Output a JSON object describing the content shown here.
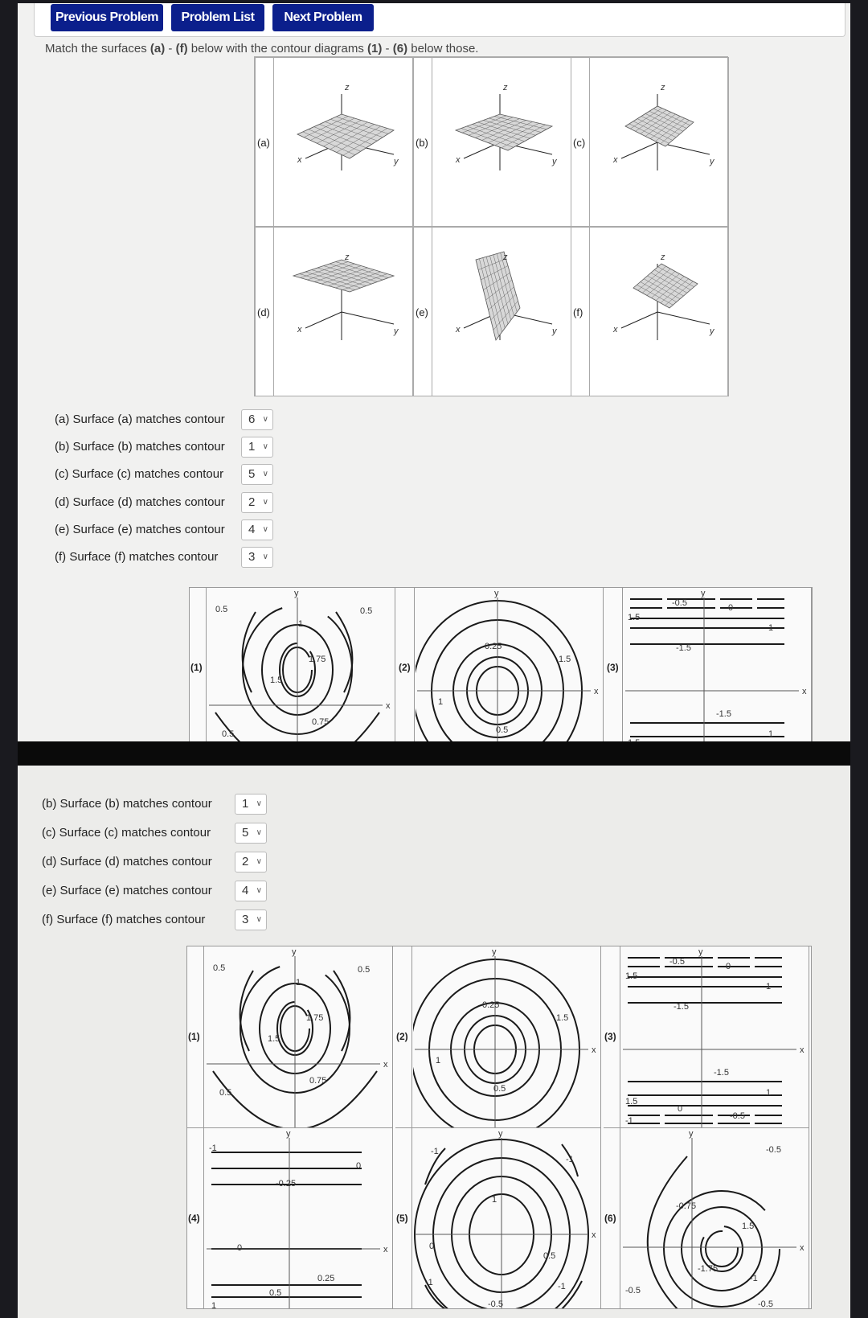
{
  "nav": {
    "previous": "Previous Problem",
    "list": "Problem List",
    "next": "Next Problem"
  },
  "prompt": {
    "pre": "Match the surfaces ",
    "a": "(a)",
    "dash1": " - ",
    "f": "(f)",
    "mid": " below with the contour diagrams ",
    "one": "(1)",
    "dash2": " - ",
    "six": "(6)",
    "post": " below those."
  },
  "surfaces": [
    {
      "label": "(a)",
      "axes": [
        "z",
        "x",
        "y"
      ]
    },
    {
      "label": "(b)",
      "axes": [
        "z",
        "x",
        "y"
      ]
    },
    {
      "label": "(c)",
      "axes": [
        "z",
        "x",
        "y"
      ]
    },
    {
      "label": "(d)",
      "axes": [
        "z",
        "x",
        "y"
      ]
    },
    {
      "label": "(e)",
      "axes": [
        "z",
        "x",
        "y"
      ]
    },
    {
      "label": "(f)",
      "axes": [
        "z",
        "x",
        "y"
      ]
    }
  ],
  "answers": [
    {
      "text": "(a) Surface (a) matches contour",
      "value": "6"
    },
    {
      "text": "(b) Surface (b) matches contour",
      "value": "1"
    },
    {
      "text": "(c) Surface (c) matches contour",
      "value": "5"
    },
    {
      "text": "(d) Surface (d) matches contour",
      "value": "2"
    },
    {
      "text": "(e) Surface (e) matches contour",
      "value": "4"
    },
    {
      "text": "(f) Surface (f) matches contour",
      "value": "3"
    }
  ],
  "contours": [
    {
      "label": "(1)",
      "axes": [
        "x",
        "y"
      ],
      "levels": [
        "0.5",
        "1",
        "1.75",
        "1.5",
        "0.75",
        "0.5",
        "0.5"
      ]
    },
    {
      "label": "(2)",
      "axes": [
        "x",
        "y"
      ],
      "levels": [
        "0.25",
        "1",
        "1.5",
        "0.5"
      ]
    },
    {
      "label": "(3)",
      "axes": [
        "x",
        "y"
      ],
      "levels": [
        "-0.5",
        "0",
        "1.5",
        "1",
        "-1.5",
        "-1.5",
        "1",
        "1.5",
        "0",
        "-0.5",
        "-1"
      ]
    },
    {
      "label": "(4)",
      "axes": [
        "x",
        "y"
      ],
      "levels": [
        "-1",
        "0",
        "-0.25",
        "0",
        "0.25",
        "0.5",
        "1"
      ]
    },
    {
      "label": "(5)",
      "axes": [
        "x",
        "y"
      ],
      "levels": [
        "-1",
        "-1",
        "1",
        "0",
        "0.5",
        "-1",
        "-1",
        "-0.5"
      ]
    },
    {
      "label": "(6)",
      "axes": [
        "x",
        "y"
      ],
      "levels": [
        "-0.5",
        "-0.75",
        "1.5",
        "-1.75",
        "-1",
        "-0.5",
        "-0.5"
      ]
    }
  ],
  "colors": {
    "button": "#0b1f8c",
    "page": "#f1f1f0"
  }
}
